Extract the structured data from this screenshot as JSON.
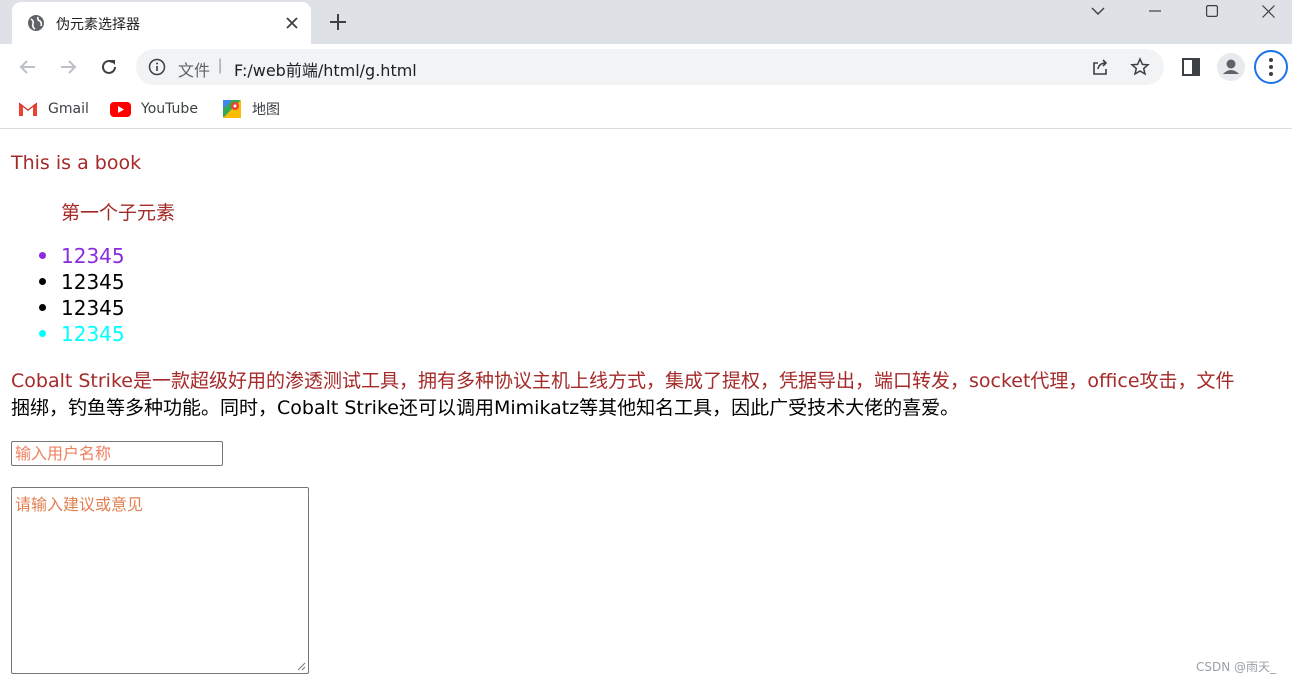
{
  "tab": {
    "title": "伪元素选择器"
  },
  "address": {
    "scheme_label": "文件",
    "separator": "|",
    "url": "F:/web前端/html/g.html"
  },
  "bookmarks": [
    {
      "label": "Gmail",
      "icon": "gmail-icon"
    },
    {
      "label": "YouTube",
      "icon": "youtube-icon"
    },
    {
      "label": "地图",
      "icon": "maps-icon"
    }
  ],
  "page": {
    "book_text": "This is a book",
    "first_child_text": "第一个子元素",
    "list_items": [
      {
        "text": "12345",
        "color": "#8a2be2"
      },
      {
        "text": "12345",
        "color": "#000000"
      },
      {
        "text": "12345",
        "color": "#000000"
      },
      {
        "text": "12345",
        "color": "#00ffff"
      }
    ],
    "paragraph_first_line": "Cobalt Strike是一款超级好用的渗透测试工具，拥有多种协议主机上线方式，集成了提权，凭据导出，端口转发，socket代理，office攻击，文件",
    "paragraph_rest": "捆绑，钓鱼等多种功能。同时，Cobalt Strike还可以调用Mimikatz等其他知名工具，因此广受技术大佬的喜爱。",
    "username_placeholder": "输入用户名称",
    "textarea_placeholder": "请输入建议或意见"
  },
  "watermark": "CSDN @雨天_",
  "colors": {
    "first_line": "#a52a2a",
    "placeholder": "#f08060",
    "accent": "#1a73e8"
  }
}
